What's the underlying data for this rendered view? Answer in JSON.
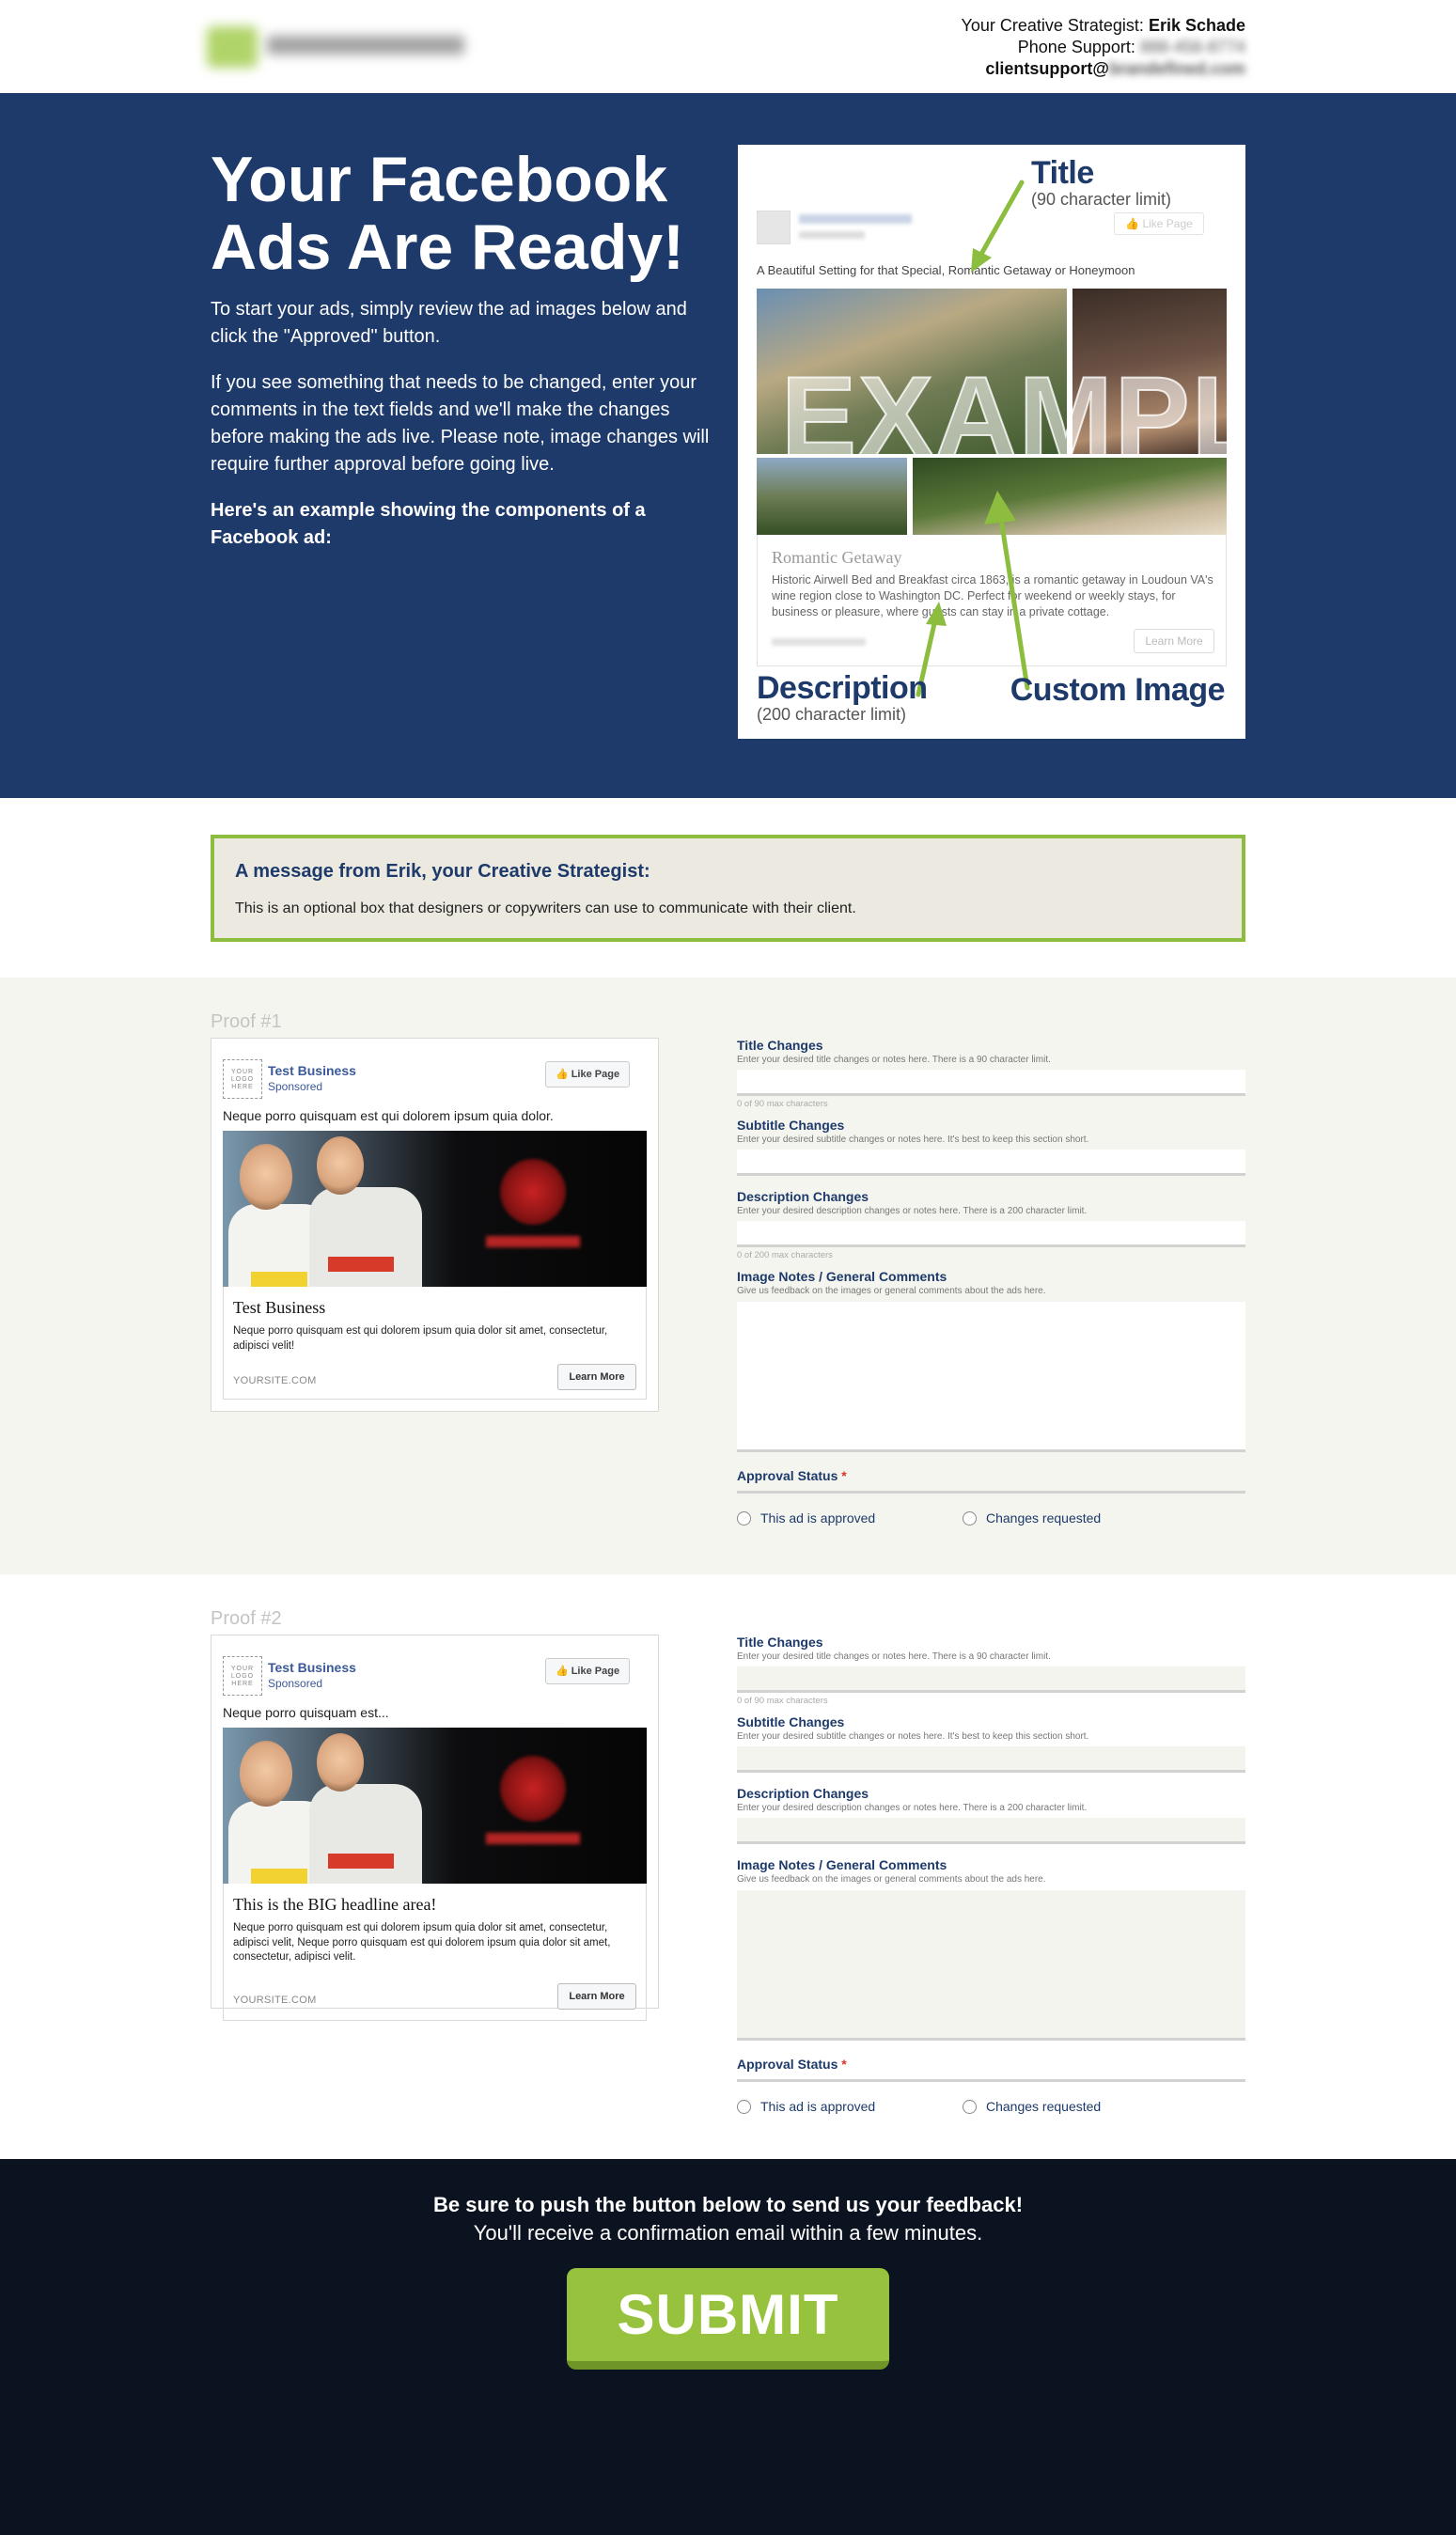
{
  "header": {
    "strategist_prefix": "Your Creative Strategist: ",
    "strategist_name": "Erik Schade",
    "phone_prefix": "Phone Support: ",
    "phone_value": "888-456-8774",
    "email_prefix": "clientsupport@",
    "email_domain": "brandefined.com"
  },
  "hero": {
    "title": "Your Facebook Ads Are Ready!",
    "para1": "To start your ads, simply review the ad images below and click the \"Approved\" button.",
    "para2": "If you see something that needs to be changed, enter your comments in the text fields and we'll make the changes before making the ads live. Please note, image changes will require further approval before going live.",
    "para3": "Here's an example showing the components of a Facebook ad:"
  },
  "example": {
    "title_label": "Title",
    "title_limit": "(90 character limit)",
    "title_text": "A Beautiful Setting for that Special, Romantic Getaway or Honeymoon",
    "like_page": "Like Page",
    "watermark": "EXAMPLE",
    "card_title": "Romantic Getaway",
    "card_desc": "Historic Airwell Bed and Breakfast circa 1863, is a romantic getaway in Loudoun VA's wine region close to Washington DC. Perfect for weekend or weekly stays, for business or pleasure, where guests can stay in a private cottage.",
    "learn_more": "Learn More",
    "desc_label": "Description",
    "desc_limit": "(200 character limit)",
    "image_label": "Custom Image",
    "arrow_color": "#8cbd3f"
  },
  "message": {
    "heading": "A message from Erik, your Creative Strategist:",
    "body": "This is an optional box that designers or copywriters can use to communicate with their client."
  },
  "proofs": [
    {
      "label": "Proof #1",
      "ad": {
        "logo_text": "YOUR LOGO HERE",
        "business": "Test Business",
        "sponsored": "Sponsored",
        "like": "Like Page",
        "text": "Neque porro quisquam est qui dolorem ipsum quia dolor.",
        "headline": "Test Business",
        "desc": "Neque porro quisquam est qui dolorem ipsum quia dolor sit amet, consectetur, adipisci velit!",
        "url": "YOURSITE.COM",
        "cta": "Learn More"
      },
      "form": {
        "title_label": "Title Changes",
        "title_hint": "Enter your desired title changes or notes here. There is a 90 character limit.",
        "title_count": "0 of 90 max characters",
        "subtitle_label": "Subtitle Changes",
        "subtitle_hint": "Enter your desired subtitle changes or notes here. It's best to keep this section short.",
        "desc_label": "Description Changes",
        "desc_hint": "Enter your desired description changes or notes here. There is a 200 character limit.",
        "desc_count": "0 of 200 max characters",
        "notes_label": "Image Notes / General Comments",
        "notes_hint": "Give us feedback on the images or general comments about the ads here.",
        "approval_label": "Approval Status",
        "required_mark": "*",
        "approved": "This ad is approved",
        "changes": "Changes requested"
      }
    },
    {
      "label": "Proof #2",
      "ad": {
        "logo_text": "YOUR LOGO HERE",
        "business": "Test Business",
        "sponsored": "Sponsored",
        "like": "Like Page",
        "text": "Neque porro quisquam est...",
        "headline": "This is the BIG headline area!",
        "desc": "Neque porro quisquam est qui dolorem ipsum quia dolor sit amet, consectetur, adipisci velit, Neque porro quisquam est qui dolorem ipsum quia dolor sit amet, consectetur, adipisci velit.",
        "url": "YOURSITE.COM",
        "cta": "Learn More"
      },
      "form": {
        "title_label": "Title Changes",
        "title_hint": "Enter your desired title changes or notes here. There is a 90 character limit.",
        "title_count": "0 of 90 max characters",
        "subtitle_label": "Subtitle Changes",
        "subtitle_hint": "Enter your desired subtitle changes or notes here. It's best to keep this section short.",
        "desc_label": "Description Changes",
        "desc_hint": "Enter your desired description changes or notes here. There is a 200 character limit.",
        "notes_label": "Image Notes / General Comments",
        "notes_hint": "Give us feedback on the images or general comments about the ads here.",
        "approval_label": "Approval Status",
        "required_mark": "*",
        "approved": "This ad is approved",
        "changes": "Changes requested"
      }
    }
  ],
  "footer": {
    "line1": "Be sure to push the button below to send us your feedback!",
    "line2": "You'll receive a confirmation email within a few minutes.",
    "submit": "SUBMIT"
  },
  "colors": {
    "hero_bg": "#1d3a6a",
    "accent_green": "#97c23d",
    "footer_bg": "#0c1320"
  }
}
